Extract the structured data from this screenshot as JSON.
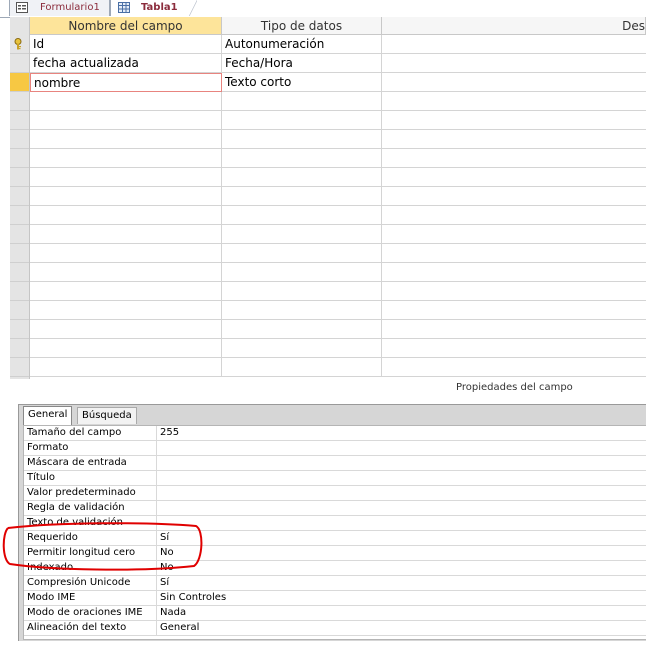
{
  "tabs": [
    {
      "label": "Formulario1",
      "icon": "form-icon"
    },
    {
      "label": "Tabla1",
      "icon": "table-icon",
      "active": true
    }
  ],
  "grid": {
    "headers": {
      "field_name": "Nombre del campo",
      "data_type": "Tipo de datos",
      "description": "Des"
    },
    "rows": [
      {
        "name": "Id",
        "type": "Autonumeración",
        "primary_key": true
      },
      {
        "name": "fecha actualizada",
        "type": "Fecha/Hora"
      },
      {
        "name": "nombre",
        "type": "Texto corto",
        "current": true
      }
    ]
  },
  "properties": {
    "title": "Propiedades del campo",
    "tabs": [
      "General",
      "Búsqueda"
    ],
    "rows": [
      {
        "label": "Tamaño del campo",
        "value": "255"
      },
      {
        "label": "Formato",
        "value": ""
      },
      {
        "label": "Máscara de entrada",
        "value": ""
      },
      {
        "label": "Título",
        "value": ""
      },
      {
        "label": "Valor predeterminado",
        "value": ""
      },
      {
        "label": "Regla de validación",
        "value": ""
      },
      {
        "label": "Texto de validación",
        "value": ""
      },
      {
        "label": "Requerido",
        "value": "Sí"
      },
      {
        "label": "Permitir longitud cero",
        "value": "No"
      },
      {
        "label": "Indexado",
        "value": "No"
      },
      {
        "label": "Compresión Unicode",
        "value": "Sí"
      },
      {
        "label": "Modo IME",
        "value": "Sin Controles"
      },
      {
        "label": "Modo de oraciones IME",
        "value": "Nada"
      },
      {
        "label": "Alineación del texto",
        "value": "General"
      }
    ]
  },
  "colors": {
    "annotation": "#e00000",
    "tab_text": "#8b2c3c",
    "header_selected": "#fde49a",
    "current_row": "#f7c843"
  }
}
